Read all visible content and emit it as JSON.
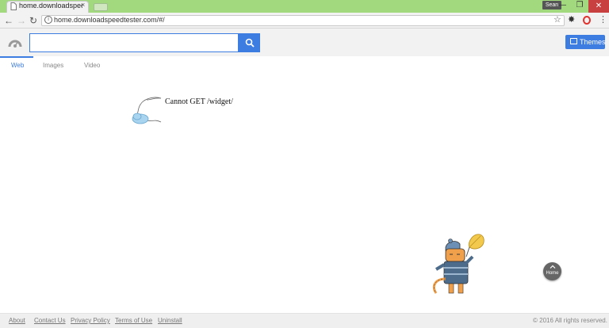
{
  "browser": {
    "tab_title": "home.downloadspeedte",
    "tab_close": "×",
    "user_badge": "Sean",
    "url": "home.downloadspeedtester.com/#/",
    "window_buttons": [
      "—",
      "❐",
      "✕"
    ]
  },
  "search": {
    "input_value": "",
    "themes_label": "Themes"
  },
  "search_tabs": [
    "Web",
    "Images",
    "Video"
  ],
  "error_message": "Cannot GET /widget/",
  "home_button_label": "Home",
  "footer": {
    "links": [
      "About",
      "Contact Us",
      "Privacy Policy",
      "Terms of Use",
      "Uninstall"
    ],
    "copyright": "© 2016 All rights reserved."
  },
  "colors": {
    "accent": "#3d7ce0",
    "titlebar": "#a3d97e",
    "close": "#c94040"
  },
  "icons": [
    "page-icon",
    "back-icon",
    "forward-icon",
    "reload-icon",
    "info-icon",
    "star-icon",
    "extension-icon",
    "opera-icon",
    "menu-icon",
    "search-icon",
    "themes-icon",
    "logo-icon"
  ]
}
